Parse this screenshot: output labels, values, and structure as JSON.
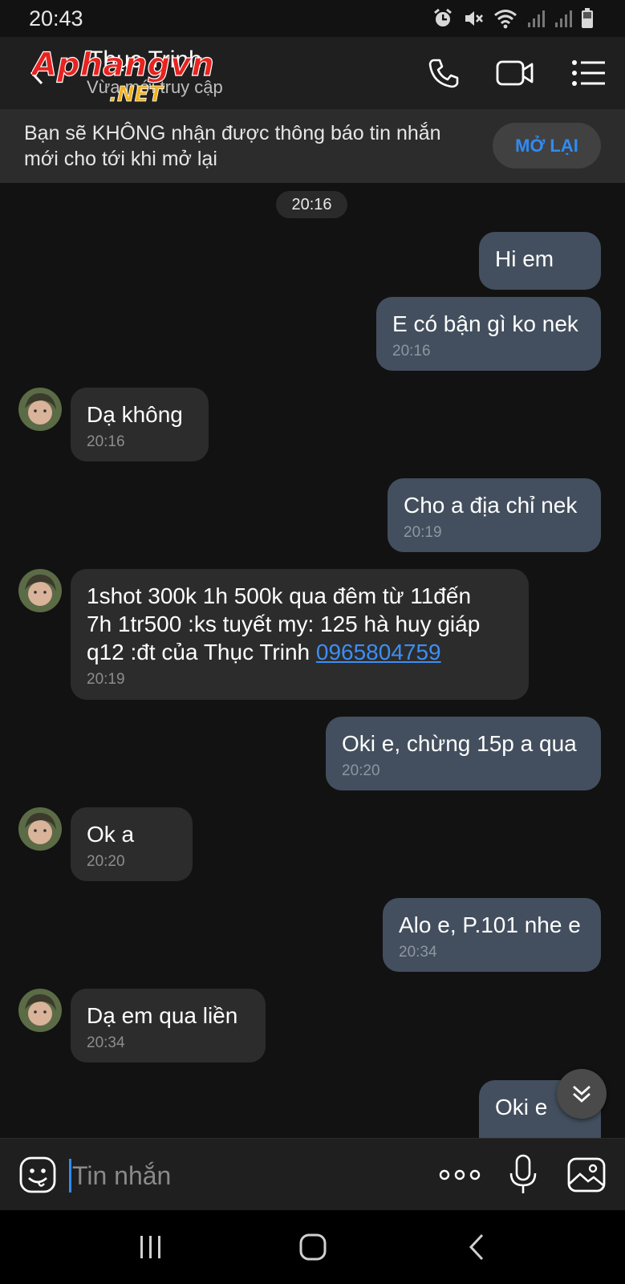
{
  "status_bar": {
    "time": "20:43",
    "icons": [
      "alarm-icon",
      "mute-icon",
      "wifi-icon",
      "signal-icon",
      "signal-icon",
      "battery-icon"
    ]
  },
  "header": {
    "contact_name": "Thục Trinh",
    "contact_status": "Vừa mới truy cập",
    "watermark_text": "Aphangvn",
    "watermark_suffix": ".NET",
    "actions": [
      "phone-icon",
      "video-call-icon",
      "menu-list-icon"
    ]
  },
  "notice": {
    "text": "Bạn sẽ KHÔNG nhận được thông báo tin nhắn mới cho tới khi mở lại",
    "button_label": "MỞ LẠI"
  },
  "chat": {
    "date_label": "20:16",
    "messages": [
      {
        "dir": "out",
        "text": "Hi em",
        "time": ""
      },
      {
        "dir": "out",
        "text": "E có bận gì ko nek",
        "time": "20:16"
      },
      {
        "dir": "in",
        "text": "Dạ không",
        "time": "20:16"
      },
      {
        "dir": "out",
        "text": "Cho a địa chỉ nek",
        "time": "20:19"
      },
      {
        "dir": "in",
        "text": "1shot 300k 1h 500k qua đêm từ 11đến\n7h 1tr500 :ks tuyết my: 125 hà huy giáp\nq12 :đt của Thục Trinh ",
        "link": "0965804759",
        "time": "20:19"
      },
      {
        "dir": "out",
        "text": "Oki e, chừng 15p a qua",
        "time": "20:20"
      },
      {
        "dir": "in",
        "text": "Ok a",
        "time": "20:20"
      },
      {
        "dir": "out",
        "text": "Alo e, P.101 nhe e",
        "time": "20:34"
      },
      {
        "dir": "in",
        "text": "Dạ em qua liền",
        "time": "20:34"
      },
      {
        "dir": "out",
        "text": "Oki e",
        "time": ""
      }
    ]
  },
  "composer": {
    "placeholder": "Tin nhắn",
    "value": ""
  },
  "colors": {
    "background": "#121212",
    "header": "#1f1f1f",
    "outgoing_bubble": "#434f5e",
    "incoming_bubble": "#2c2c2c",
    "accent": "#2f8bf5",
    "watermark_red": "#e8231f"
  }
}
